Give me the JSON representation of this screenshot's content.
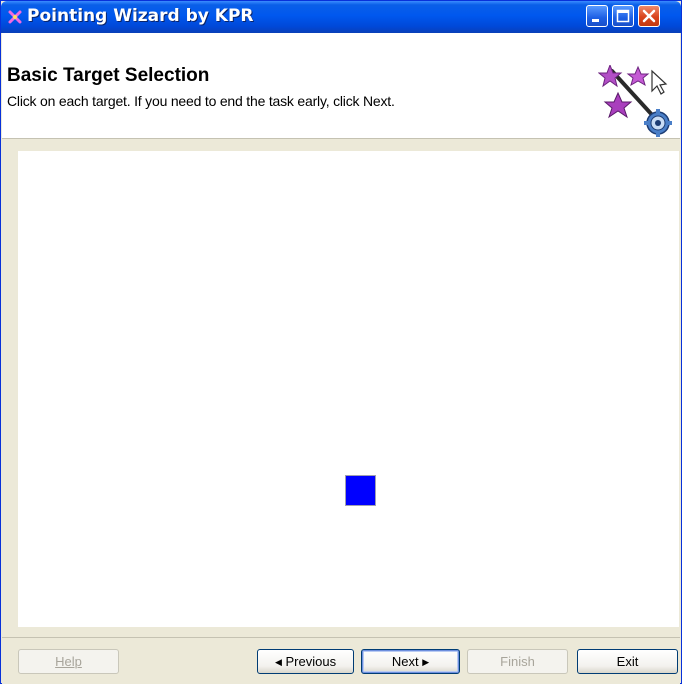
{
  "window": {
    "title": "Pointing Wizard by KPR"
  },
  "header": {
    "title": "Basic Target Selection",
    "description": "Click on each target. If you need to end the task early, click Next."
  },
  "canvas": {
    "target_color": "#0000ff"
  },
  "footer": {
    "help_label": "Help",
    "previous_label": "Previous",
    "next_label": "Next",
    "finish_label": "Finish",
    "exit_label": "Exit"
  },
  "colors": {
    "titlebar": "#0058ee",
    "window_bg": "#ece9d8",
    "accent": "#0000ff"
  },
  "icons": [
    "app-icon",
    "minimize-icon",
    "maximize-icon",
    "close-icon",
    "wizard-logo-icon",
    "left-arrow-icon",
    "right-arrow-icon"
  ]
}
